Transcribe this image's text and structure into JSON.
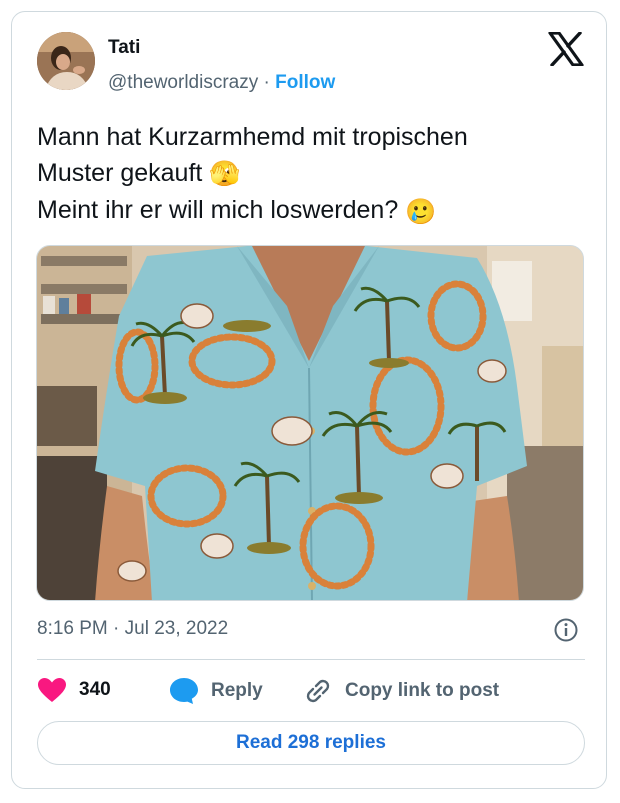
{
  "author": {
    "name": "Tati",
    "handle": "@theworldiscrazy",
    "separator": "·",
    "follow_label": "Follow"
  },
  "icons": {
    "platform": "x-logo",
    "info": "info-icon",
    "like": "heart-icon",
    "reply": "speech-bubble-icon",
    "copy": "link-icon"
  },
  "tweet": {
    "line1": "Mann hat Kurzarmhemd mit tropischen",
    "line2": "Muster gekauft",
    "line2_emoji": "🫣",
    "line3": "Meint ihr er will mich loswerden?",
    "line3_emoji": "🥲",
    "timestamp": "8:16 PM · Jul 23, 2022"
  },
  "actions": {
    "like_count": "340",
    "reply_label": "Reply",
    "copy_label": "Copy link to post"
  },
  "read_replies_label": "Read 298 replies",
  "colors": {
    "link_blue": "#1d9bf0",
    "heart": "#f91880",
    "shirt": "#8ec6d0",
    "palm": "#3b5a1e",
    "lei": "#d9813a"
  }
}
